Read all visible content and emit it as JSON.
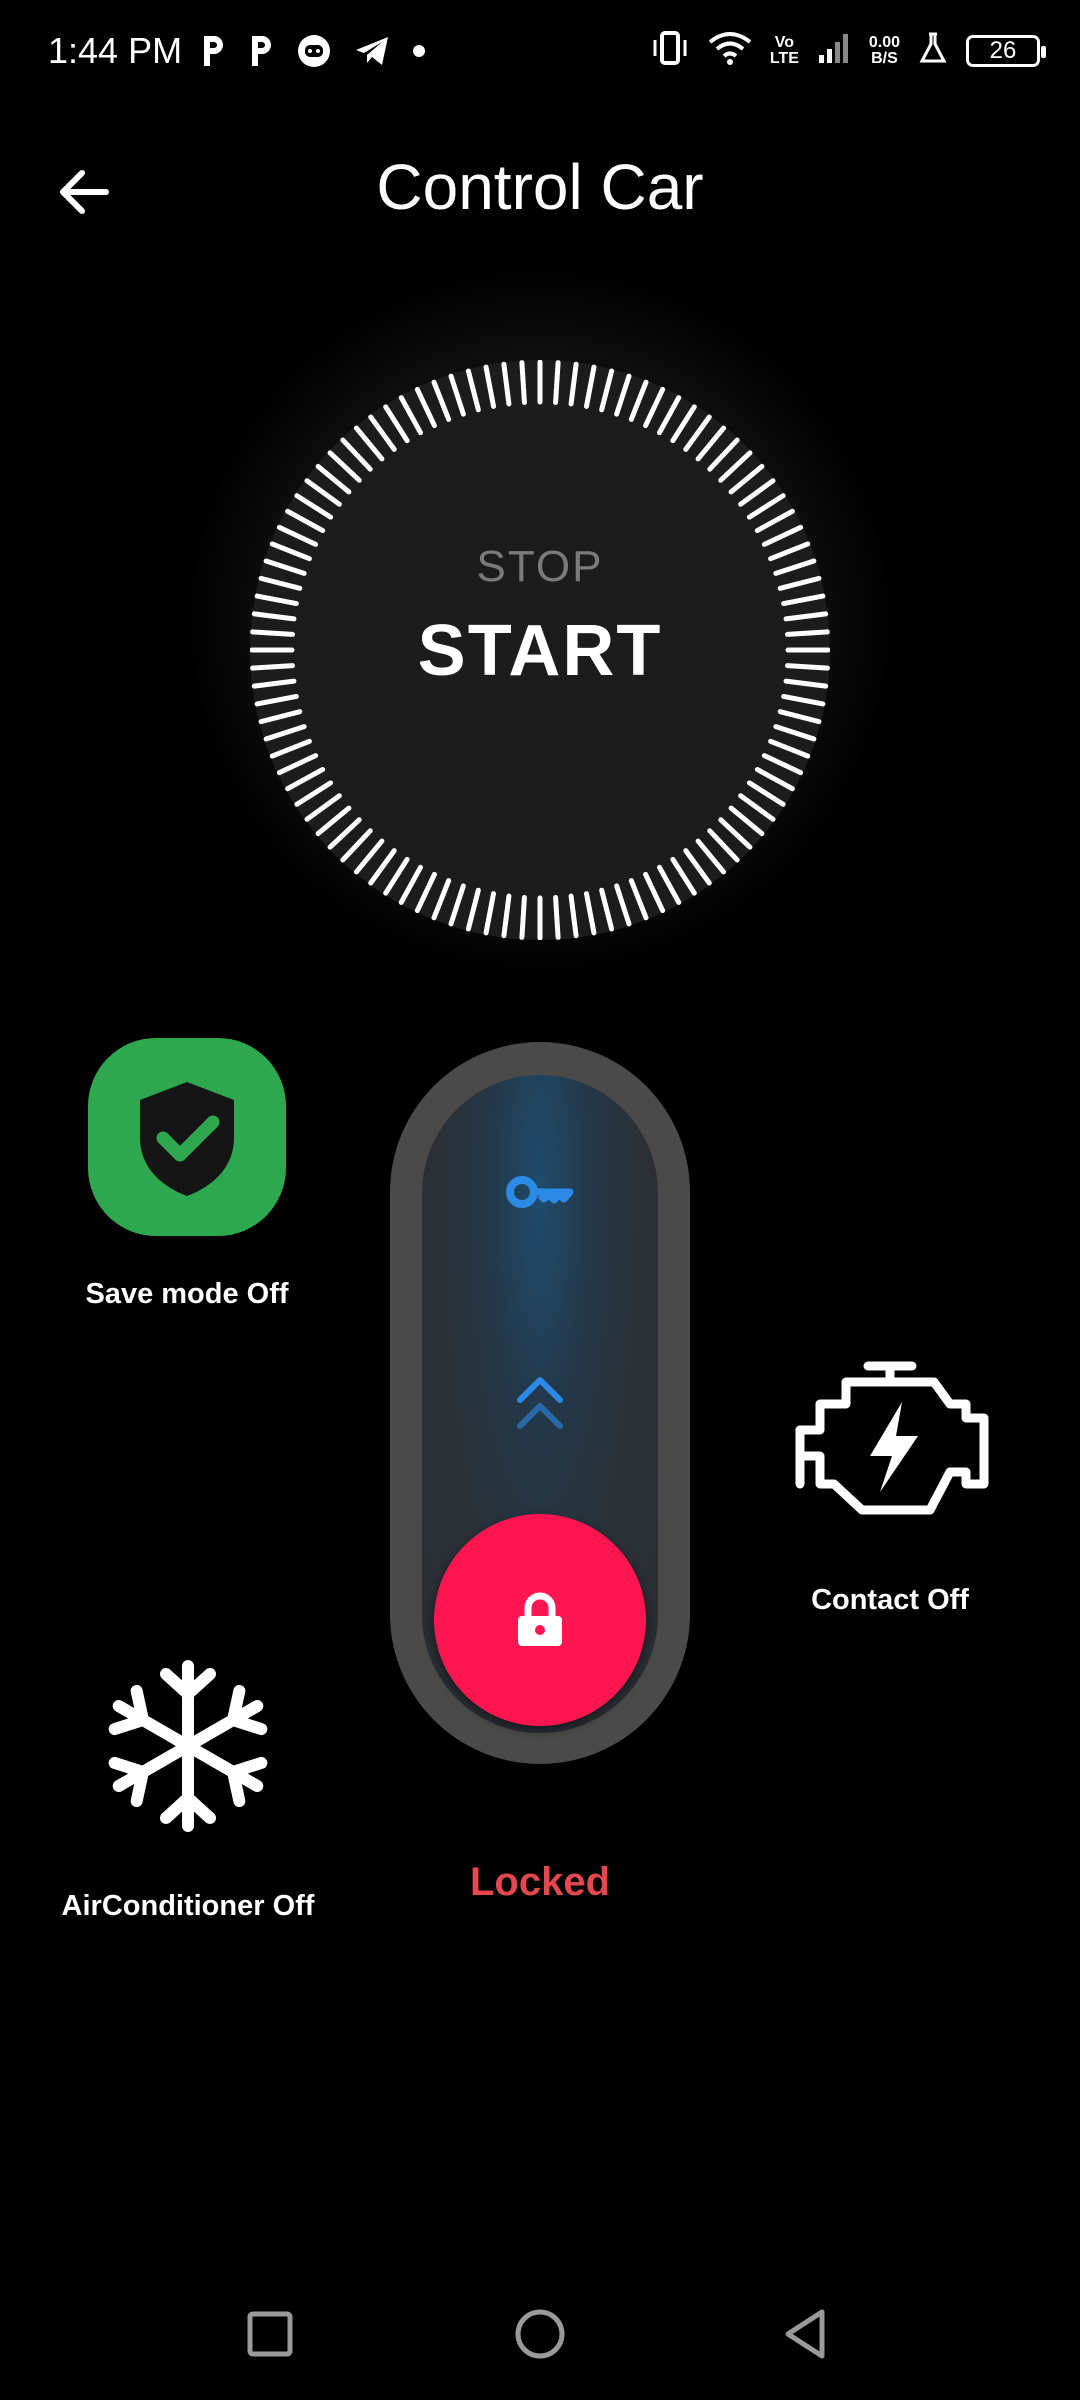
{
  "status_bar": {
    "time": "1:44 PM",
    "left_icons": [
      "p-icon",
      "p-icon",
      "discord-icon",
      "telegram-icon",
      "dot-icon"
    ],
    "network_label_top": "Vo",
    "network_label_bottom": "LTE",
    "speed_value": "0.00",
    "speed_unit": "B/S",
    "battery_level": "26"
  },
  "header": {
    "title": "Control Car",
    "back_icon": "arrow-left-icon"
  },
  "engine_dial": {
    "stop_label": "STOP",
    "start_label": "START"
  },
  "features": {
    "save_mode_label": "Save mode Off",
    "contact_label": "Contact Off",
    "air_conditioner_label": "AirConditioner Off"
  },
  "lock_slider": {
    "status_label": "Locked",
    "key_icon": "key-icon",
    "lock_icon": "lock-icon"
  },
  "colors": {
    "save_mode_green": "#2ea84f",
    "lock_red": "#ff1650",
    "locked_text": "#e5474f",
    "key_blue": "#2b8be6"
  },
  "nav_bar": {
    "buttons": [
      "square-recents-icon",
      "circle-home-icon",
      "triangle-back-icon"
    ]
  }
}
